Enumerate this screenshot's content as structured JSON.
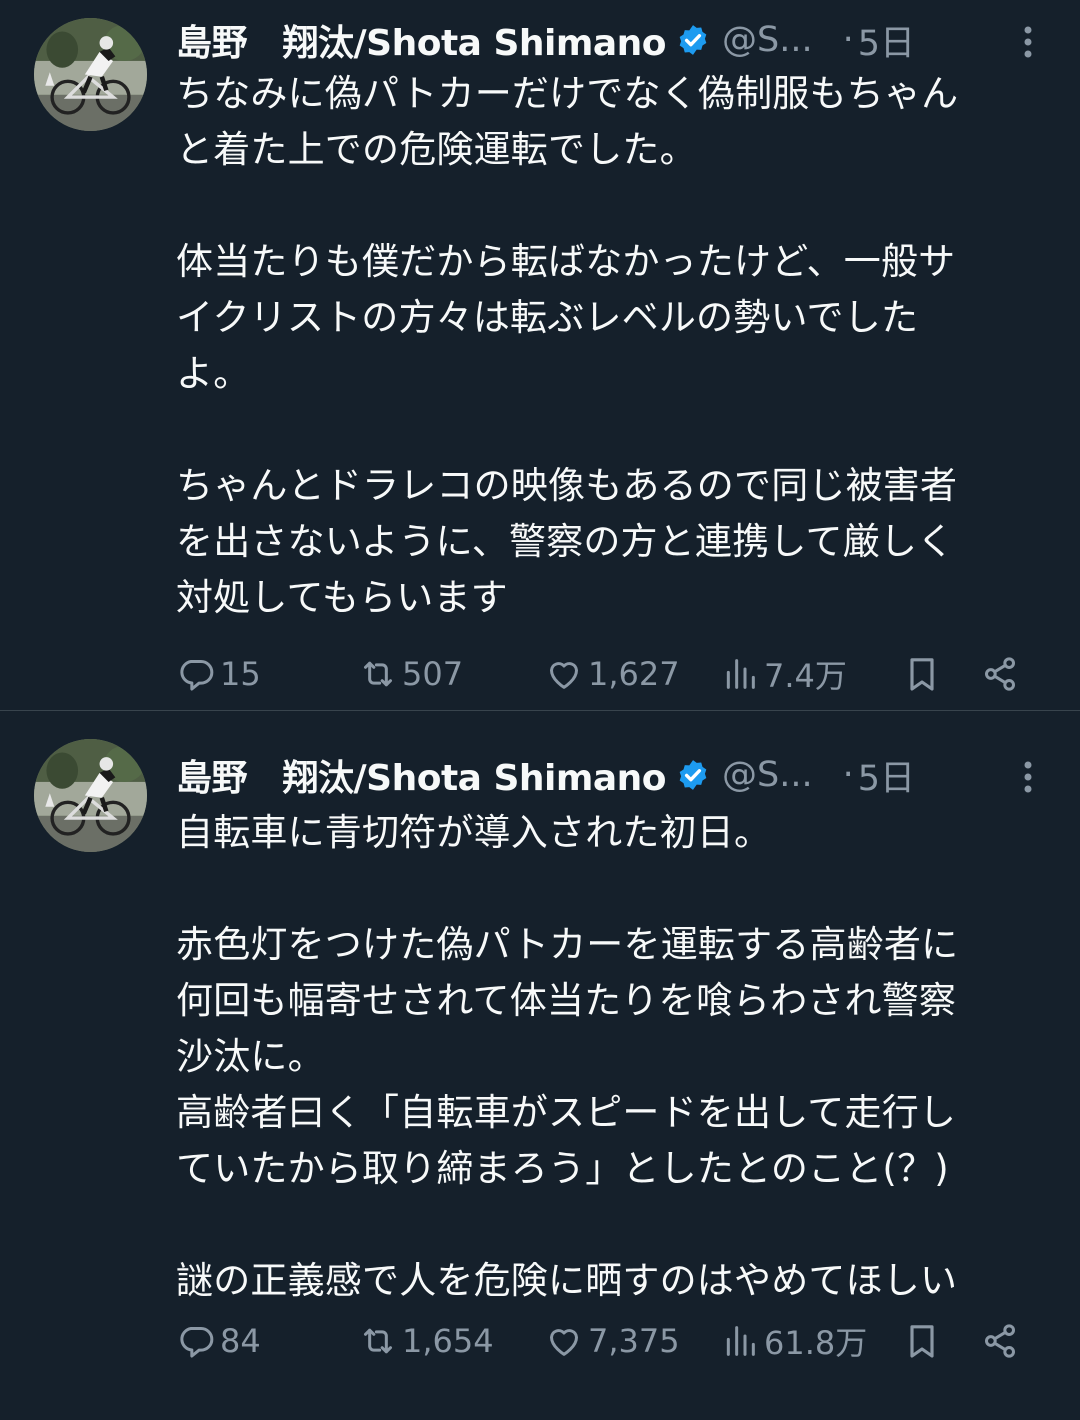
{
  "tweets": [
    {
      "author_name": "島野　翔汰/Shota Shimano",
      "handle": "@S...",
      "separator": "·",
      "time": "5日",
      "text": "ちなみに偽パトカーだけでなく偽制服もちゃん\nと着た上での危険運転でした。\n\n体当たりも僕だから転ばなかったけど、一般サ\nイクリストの方々は転ぶレベルの勢いでした\nよ。\n\nちゃんとドラレコの映像もあるので同じ被害者\nを出さないように、警察の方と連携して厳しく\n対処してもらいます",
      "replies": "15",
      "retweets": "507",
      "likes": "1,627",
      "views": "7.4万"
    },
    {
      "author_name": "島野　翔汰/Shota Shimano",
      "handle": "@S...",
      "separator": "·",
      "time": "5日",
      "text": "自転車に青切符が導入された初日。\n\n赤色灯をつけた偽パトカーを運転する高齢者に\n何回も幅寄せされて体当たりを喰らわされ警察\n沙汰に。\n高齢者曰く「自転車がスピードを出して走行し\nていたから取り締まろう」としたとのこと(？)\n\n謎の正義感で人を危険に晒すのはやめてほしい",
      "replies": "84",
      "retweets": "1,654",
      "likes": "7,375",
      "views": "61.8万"
    }
  ],
  "colors": {
    "background": "#15202b",
    "text": "#f7f9f9",
    "muted": "#8b98a5",
    "verified": "#1d9bf0",
    "divider": "#38444d"
  }
}
